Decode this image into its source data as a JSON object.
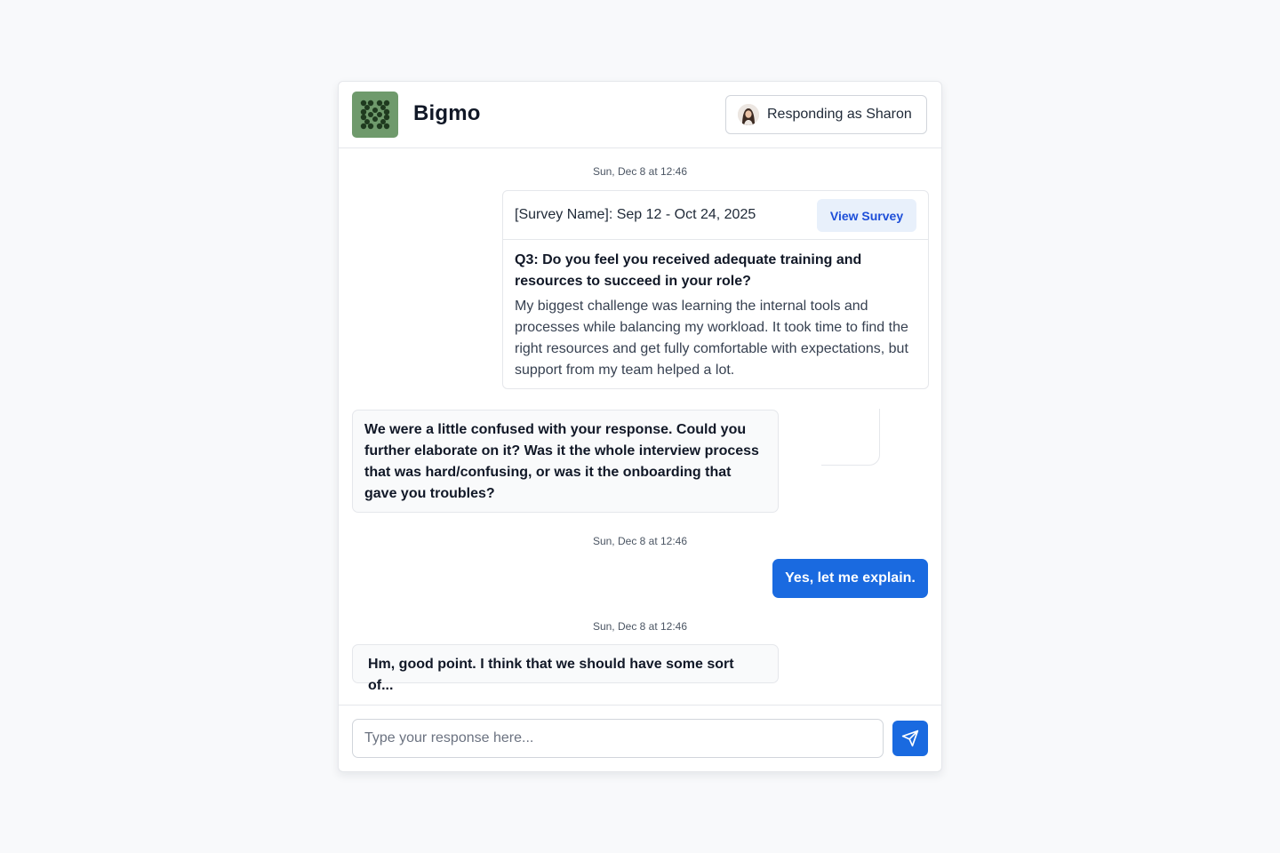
{
  "header": {
    "brand": "Bigmo",
    "logo_icon": "dot-pattern-logo",
    "responding_label": "Responding as Sharon",
    "avatar_icon": "user-avatar"
  },
  "conversation": {
    "timestamp_1": "Sun, Dec 8 at 12:46",
    "survey": {
      "title": "[Survey Name]: Sep 12 - Oct 24, 2025",
      "view_button": "View Survey",
      "question": "Q3: Do you feel you received adequate training and resources to succeed in your role?",
      "answer": "My biggest challenge was learning the internal tools and processes while balancing my workload. It took time to find the right resources and get fully comfortable with expectations, but support from my team helped a lot."
    },
    "message_1": "We were a little confused with your response. Could you further elaborate on it? Was it the whole interview process that was hard/confusing, or was it the onboarding that gave you troubles?",
    "timestamp_2": "Sun, Dec 8 at 12:46",
    "reply_1": "Yes, let me explain.",
    "timestamp_3": "Sun, Dec 8 at 12:46",
    "message_2": "Hm, good point. I think that we should have some sort of..."
  },
  "composer": {
    "placeholder": "Type your response here...",
    "send_icon": "send-paper-plane-icon"
  },
  "colors": {
    "accent": "#1a6ae0",
    "logo_bg": "#6f9a6c",
    "background": "#f8f9fb"
  }
}
